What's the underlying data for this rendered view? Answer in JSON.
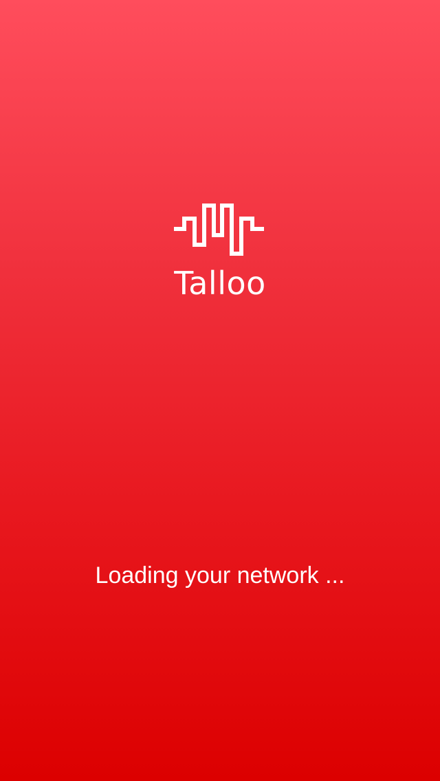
{
  "splash": {
    "brand_name": "Talloo",
    "loading_message": "Loading your network ...",
    "logo_icon": "sound-wave-logo-icon"
  },
  "colors": {
    "background_top": "#ff4d5c",
    "background_bottom": "#dc0000",
    "foreground": "#ffffff"
  }
}
